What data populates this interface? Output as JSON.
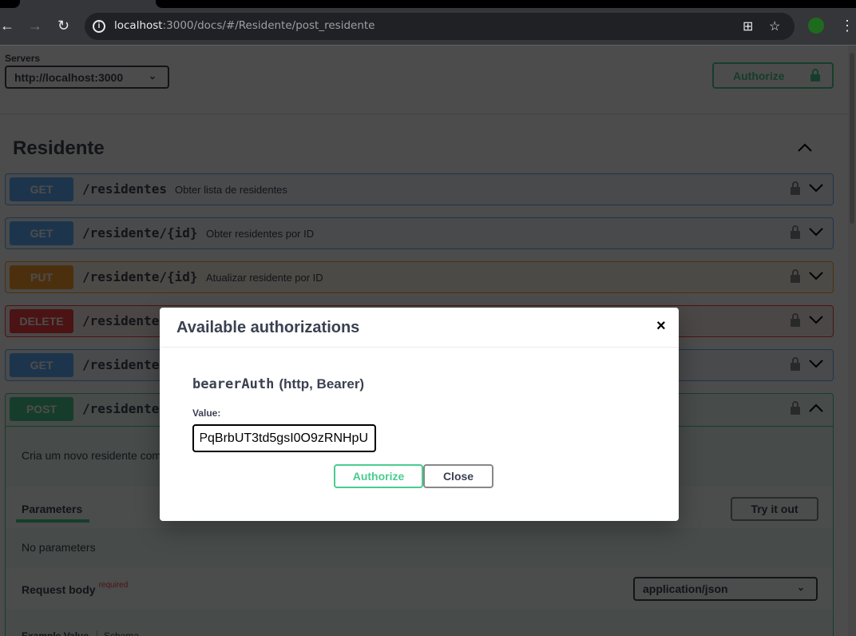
{
  "browser": {
    "url_host": "localhost",
    "url_rest": ":3000/docs/#/Residente/post_residente"
  },
  "servers": {
    "label": "Servers",
    "selected": "http://localhost:3000"
  },
  "authorize_label": "Authorize",
  "tag": "Residente",
  "operations": [
    {
      "method": "GET",
      "path": "/residentes",
      "summary": "Obter lista de residentes"
    },
    {
      "method": "GET",
      "path": "/residente/{id}",
      "summary": "Obter residentes por ID"
    },
    {
      "method": "PUT",
      "path": "/residente/{id}",
      "summary": "Atualizar residente por ID"
    },
    {
      "method": "DELETE",
      "path": "/residente",
      "summary": ""
    },
    {
      "method": "GET",
      "path": "/residente",
      "summary": ""
    },
    {
      "method": "POST",
      "path": "/residente",
      "summary": ""
    }
  ],
  "post_detail": {
    "description": "Cria um novo residente com",
    "parameters_tab": "Parameters",
    "try_it_out": "Try it out",
    "no_parameters": "No parameters",
    "request_body": "Request body",
    "required": "required",
    "content_type": "application/json",
    "example_value": "Example Value",
    "schema": "Schema"
  },
  "modal": {
    "title": "Available authorizations",
    "close_icon": "×",
    "scheme_name": "bearerAuth",
    "scheme_type": "(http, Bearer)",
    "value_label": "Value:",
    "value": "PqBrbUT3td5gsI0O9zRNHpU",
    "authorize": "Authorize",
    "close": "Close"
  },
  "colors": {
    "get": "#61affe",
    "put": "#fca130",
    "delete": "#f93e3e",
    "post": "#49cc90"
  }
}
